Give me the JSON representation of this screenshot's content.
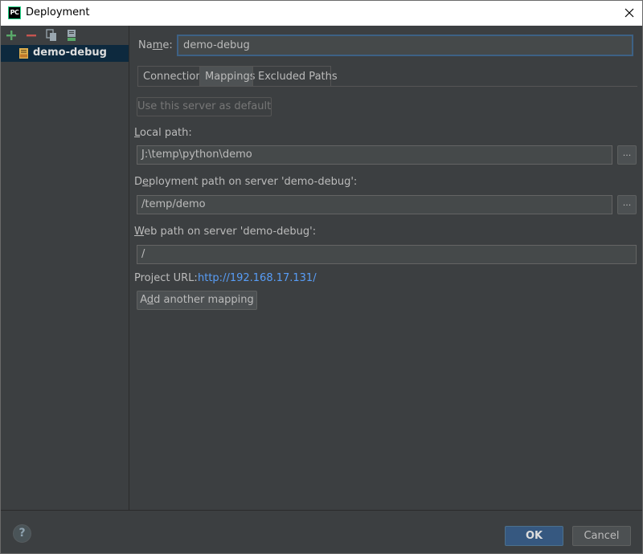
{
  "window": {
    "title": "Deployment",
    "app_icon_text": "PC"
  },
  "toolbar": {
    "icons": [
      "add-icon",
      "remove-icon",
      "copy-icon",
      "save-icon"
    ]
  },
  "tree": {
    "items": [
      {
        "label": "demo-debug",
        "icon": "server-sftp-icon"
      }
    ]
  },
  "form": {
    "name_label_pre": "Na",
    "name_label_mnemonic": "m",
    "name_label_post": "e:",
    "name_value": "demo-debug"
  },
  "tabs": [
    {
      "label": "Connection",
      "active": false
    },
    {
      "label": "Mappings",
      "active": true
    },
    {
      "label": "Excluded Paths",
      "active": false
    }
  ],
  "mappings": {
    "default_button": "Use this server as default",
    "local_path_label_mnemonic": "L",
    "local_path_label_rest": "ocal path:",
    "local_path_value": "J:\\temp\\python\\demo",
    "deploy_path_label_pre": "D",
    "deploy_path_label_mnemonic": "e",
    "deploy_path_label_rest": "ployment path on server 'demo-debug':",
    "deploy_path_value": "/temp/demo",
    "web_path_label_mnemonic": "W",
    "web_path_label_rest": "eb path on server 'demo-debug':",
    "web_path_value": "/",
    "browse_label": "...",
    "project_url_label": "Project URL:",
    "project_url_value": "http://192.168.17.131/",
    "add_mapping_pre": "A",
    "add_mapping_mnemonic": "d",
    "add_mapping_rest": "d another mapping"
  },
  "footer": {
    "help_label": "?",
    "ok_label": "OK",
    "cancel_label": "Cancel"
  },
  "colors": {
    "background": "#3c3f41",
    "selection": "#0d293e",
    "link": "#589df6",
    "ok_button": "#365880",
    "add_icon": "#59a869",
    "remove_icon": "#c75450"
  }
}
